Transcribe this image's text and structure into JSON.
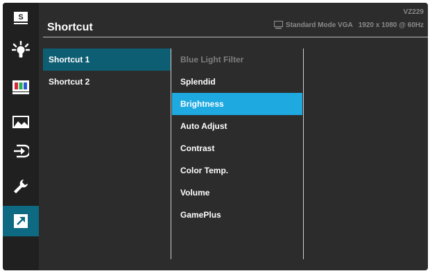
{
  "header": {
    "title": "Shortcut",
    "model": "VZ229",
    "mode": "Standard Mode VGA",
    "resolution": "1920 x 1080 @ 60Hz"
  },
  "sidebar": {
    "items": [
      {
        "name": "splendid-icon",
        "active": false
      },
      {
        "name": "blue-light-icon",
        "active": false
      },
      {
        "name": "color-icon",
        "active": false
      },
      {
        "name": "image-icon",
        "active": false
      },
      {
        "name": "input-select-icon",
        "active": false
      },
      {
        "name": "system-setup-icon",
        "active": false
      },
      {
        "name": "shortcut-icon",
        "active": true
      }
    ]
  },
  "shortcut_slots": [
    {
      "label": "Shortcut 1",
      "active": true
    },
    {
      "label": "Shortcut 2",
      "active": false
    }
  ],
  "functions": [
    {
      "label": "Blue Light Filter",
      "state": "disabled"
    },
    {
      "label": "Splendid",
      "state": "normal"
    },
    {
      "label": "Brightness",
      "state": "selected"
    },
    {
      "label": "Auto Adjust",
      "state": "normal"
    },
    {
      "label": "Contrast",
      "state": "normal"
    },
    {
      "label": "Color Temp.",
      "state": "normal"
    },
    {
      "label": "Volume",
      "state": "normal"
    },
    {
      "label": "GamePlus",
      "state": "normal"
    }
  ],
  "colors": {
    "background": "#2c2c2c",
    "sidebar": "#202020",
    "sidebar_active": "#0e6a82",
    "slot_active": "#0e5e73",
    "selected": "#1ea9e1",
    "disabled_text": "#7f7f7f"
  }
}
